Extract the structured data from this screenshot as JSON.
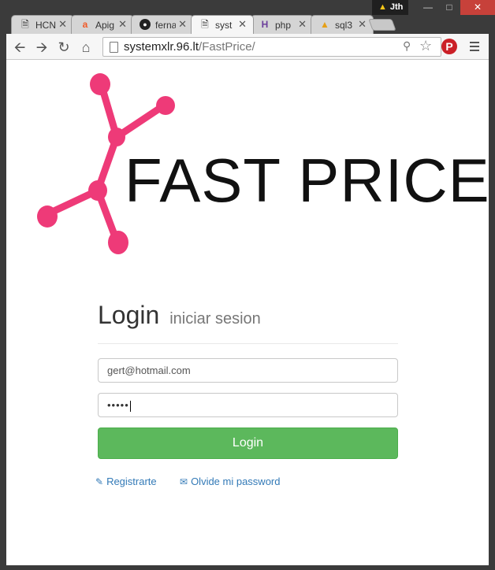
{
  "window": {
    "user_name": "Jth",
    "minimize": "—",
    "maximize": "□",
    "close": "✕"
  },
  "tabs": [
    {
      "label": "HCN",
      "icon": "page-icon"
    },
    {
      "label": "Apig",
      "icon": "apigee-icon"
    },
    {
      "label": "ferna",
      "icon": "github-icon"
    },
    {
      "label": "syst",
      "icon": "page-icon",
      "active": true
    },
    {
      "label": "php",
      "icon": "heroku-icon"
    },
    {
      "label": "sql3",
      "icon": "phpmyadmin-icon"
    }
  ],
  "toolbar": {
    "url_host": "systemxlr.96.lt",
    "url_path": "/FastPrice/",
    "pinterest": "P"
  },
  "logo": {
    "text": "FAST PRICE",
    "accent_color": "#ee3a78"
  },
  "login": {
    "title": "Login",
    "subtitle": "iniciar sesion",
    "email_value": "gert@hotmail.com",
    "password_mask": "•••••",
    "button_label": "Login",
    "register_link": "Registrarte",
    "forgot_link": "Olvide mi password"
  },
  "colors": {
    "button_green": "#5cb85c",
    "link_blue": "#337ab7"
  }
}
